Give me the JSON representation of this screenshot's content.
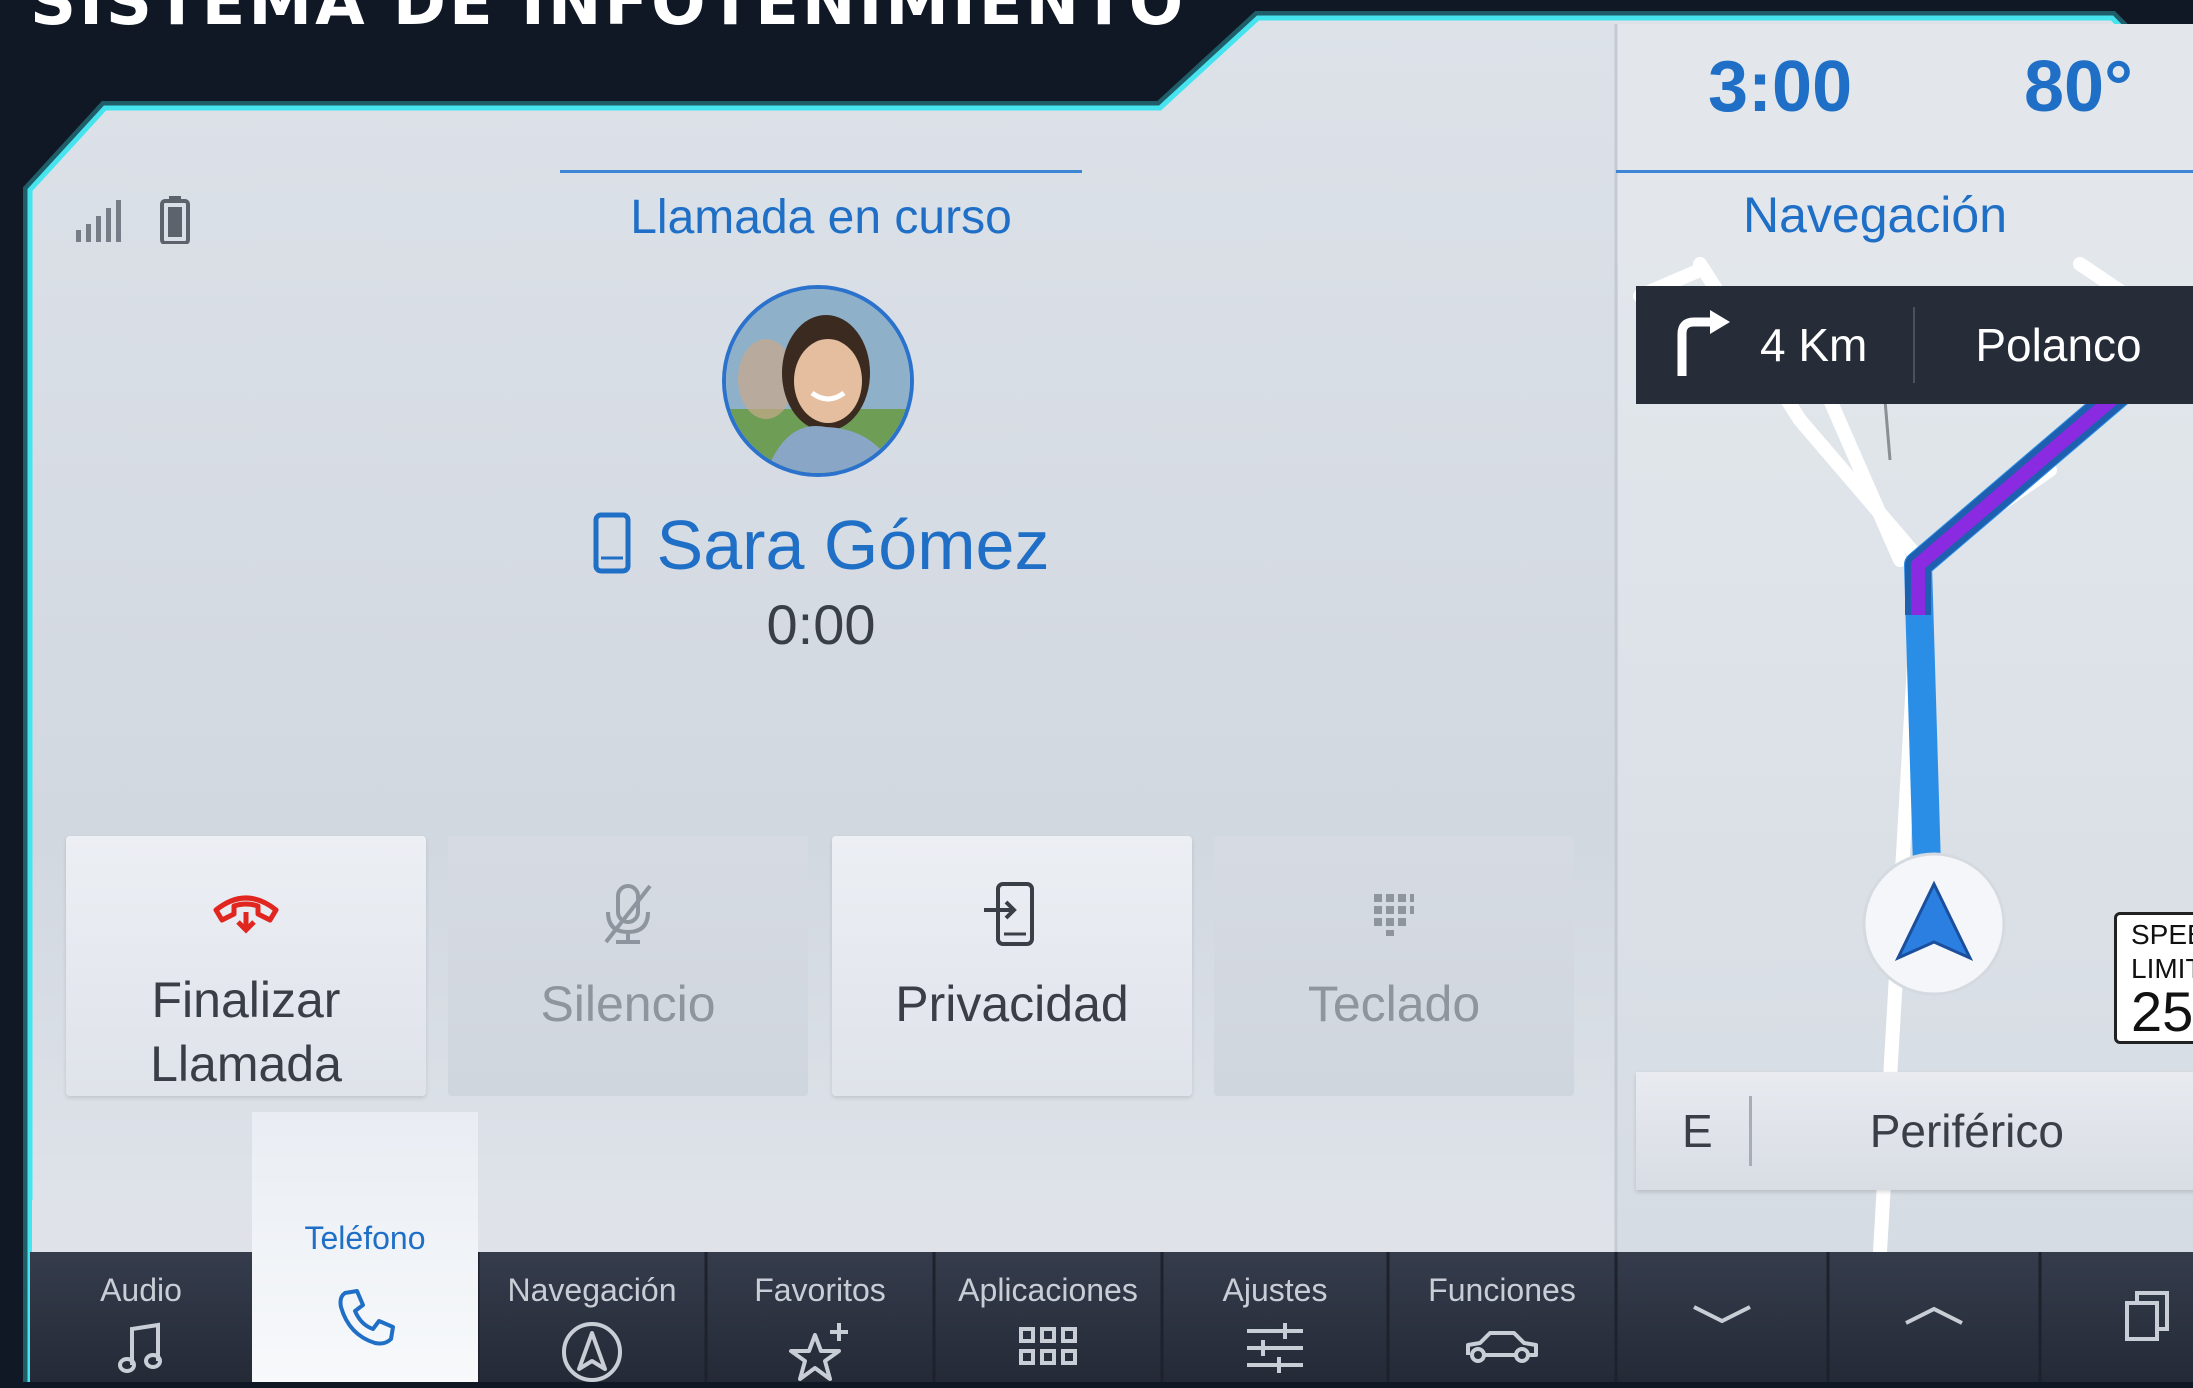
{
  "header": {
    "title": "SISTEMA DE INFOTENIMIENTO"
  },
  "status": {
    "signal_icon": "signal-bars-icon",
    "battery_icon": "battery-icon"
  },
  "call": {
    "tab_title": "Llamada en curso",
    "caller_name": "Sara Gómez",
    "device_icon": "mobile-phone-icon",
    "duration": "0:00"
  },
  "actions": [
    {
      "label": "Finalizar\nLlamada",
      "icon": "end-call-icon",
      "state": "enabled"
    },
    {
      "label": "Silencio",
      "icon": "mic-off-icon",
      "state": "disabled"
    },
    {
      "label": "Privacidad",
      "icon": "privacy-phone-icon",
      "state": "enabled"
    },
    {
      "label": "Teclado",
      "icon": "keypad-icon",
      "state": "disabled"
    }
  ],
  "side_panel": {
    "time": "3:00",
    "temperature": "80°",
    "title": "Navegación",
    "next_turn": {
      "distance": "4 Km",
      "street": "Polanco",
      "icon": "turn-right-icon"
    },
    "current_street": {
      "direction": "E",
      "name": "Periférico"
    },
    "speed_limit": {
      "label_line1": "SPEED",
      "label_line2": "LIMIT",
      "value": "25"
    }
  },
  "bottom_nav": {
    "items": [
      {
        "label": "Audio",
        "icon": "music-note-icon"
      },
      {
        "label": "Teléfono",
        "icon": "phone-icon",
        "active": true
      },
      {
        "label": "Navegación",
        "icon": "navigation-arrow-icon"
      },
      {
        "label": "Favoritos",
        "icon": "star-plus-icon"
      },
      {
        "label": "Aplicaciones",
        "icon": "apps-grid-icon"
      },
      {
        "label": "Ajustes",
        "icon": "sliders-icon"
      },
      {
        "label": "Funciones",
        "icon": "car-icon"
      }
    ],
    "controls": [
      {
        "icon": "chevron-down-icon"
      },
      {
        "icon": "chevron-up-icon"
      },
      {
        "icon": "windows-icon"
      }
    ]
  },
  "colors": {
    "accent": "#1f6fc7",
    "frame_glow": "#3fe0ea",
    "end_call": "#e0261f",
    "route": "#8a2be2",
    "route_blue": "#2b8ee6",
    "nav_bar": "#2b3140"
  }
}
